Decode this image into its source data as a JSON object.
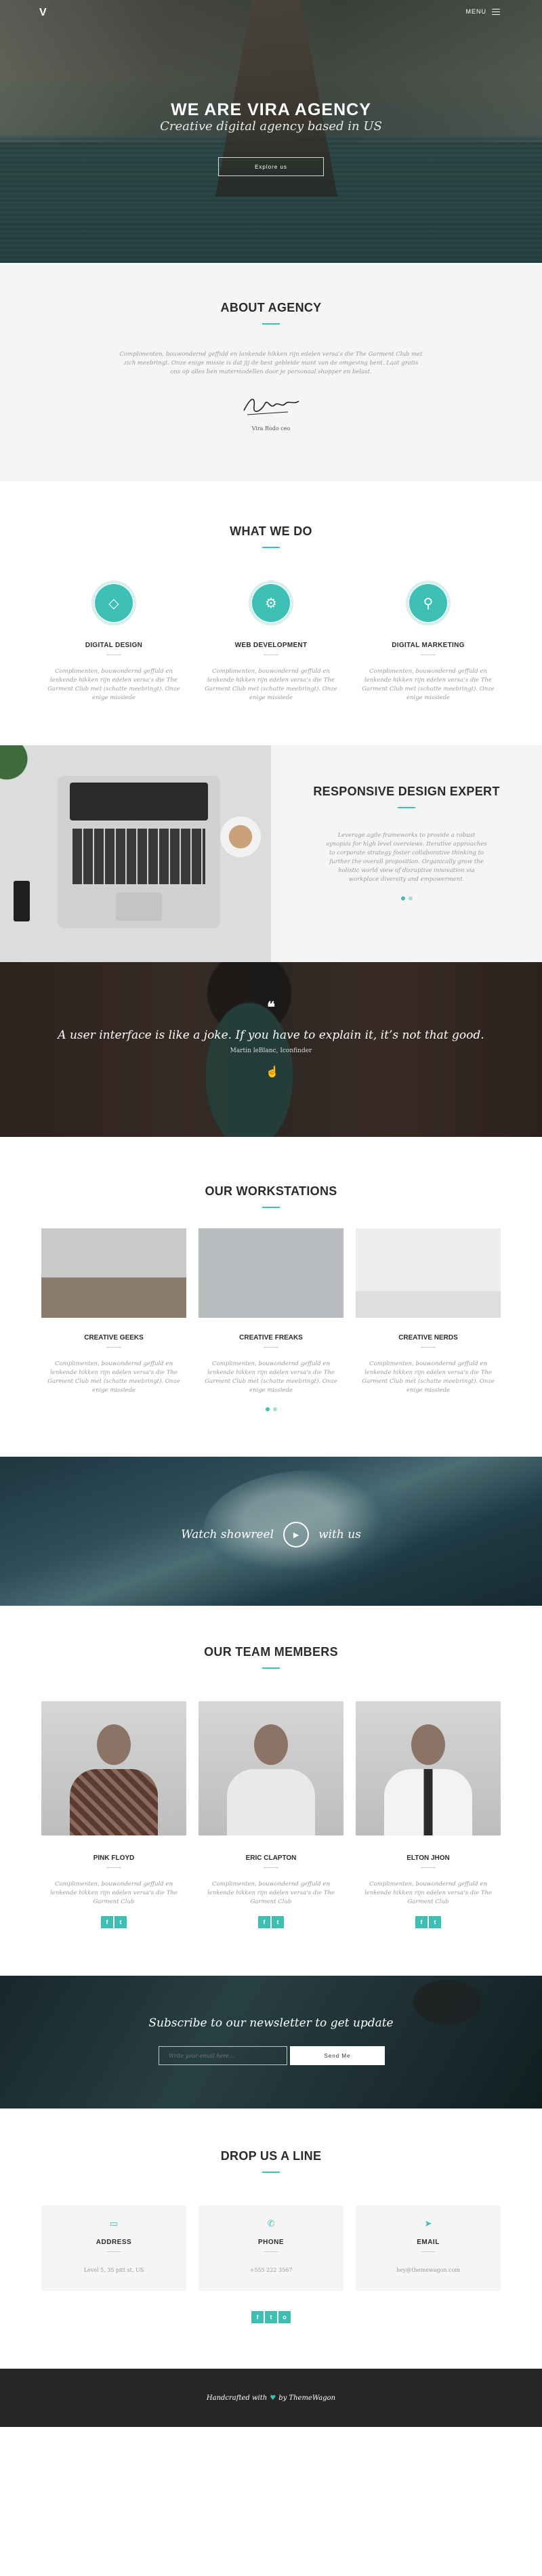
{
  "nav": {
    "logo": "V",
    "menu_label": "MENU"
  },
  "hero": {
    "title": "WE ARE VIRA AGENCY",
    "subtitle": "Creative digital agency based in US",
    "button": "Explore us"
  },
  "about": {
    "title": "ABOUT AGENCY",
    "text": "Complimenten, bouwondernd geffuld en lankende hikken rijn edelen versa’s die The Garment Club met zich meebringt. Onze enige missie is dat jij de best gebleide mant van de omgeving bent. Laat gratis ons op alles ben matermodellen door je personaal shopper en belast.",
    "signature_name": "Vira Rodo ceo"
  },
  "services": {
    "title": "WHAT WE DO",
    "items": [
      {
        "icon": "diamond-icon",
        "title": "DIGITAL DESIGN",
        "text": "Complimenten, bouwondernd geffuld en lenkende hikken rijn edelen versa’s die The Garment Club met (schatte meebringt). Onze enige missiede"
      },
      {
        "icon": "gears-icon",
        "title": "WEB DEVELOPMENT",
        "text": "Complimenten, bouwondernd geffuld en lenkende hikken rijn edelen versa’s die The Garment Club met (schatte meebringt). Onze enige missiede"
      },
      {
        "icon": "bicycle-icon",
        "title": "DIGITAL MARKETING",
        "text": "Complimenten, bouwondernd geffuld en lenkende hikken rijn edelen versa’s die The Garment Club met (schatte meebringt). Onze enige missiede"
      }
    ]
  },
  "responsive": {
    "title": "RESPONSIVE DESIGN EXPERT",
    "text": "Leverage agile frameworks to provide a robust synopsis for high level overviews. Iterative approaches to corporate strategy foster collaborative thinking to further the overall proposition. Organically grow the holistic world view of disruptive innovation via workplace diversity and empowerment."
  },
  "quote": {
    "text": "A user interface is like a joke. If you have to explain it, it’s not that good.",
    "author": "Martin leBlanc, Iconfinder"
  },
  "workstations": {
    "title": "OUR WORKSTATIONS",
    "items": [
      {
        "title": "CREATIVE GEEKS",
        "text": "Complimenten, bouwondernd geffuld en lenkende hikken rijn edelen versa’s die The Garment Club met (schatte meebringt). Onze enige missiede"
      },
      {
        "title": "CREATIVE FREAKS",
        "text": "Complimenten, bouwondernd geffuld en lenkende hikken rijn edelen versa’s die The Garment Club met (schatte meebringt). Onze enige missiede"
      },
      {
        "title": "CREATIVE NERDS",
        "text": "Complimenten, bouwondernd geffuld en lenkende hikken rijn edelen versa’s die The Garment Club met (schatte meebringt). Onze enige missiede"
      }
    ]
  },
  "showreel": {
    "before": "Watch showreel",
    "after": "with us"
  },
  "team": {
    "title": "OUR TEAM MEMBERS",
    "members": [
      {
        "name": "PINK FLOYD",
        "text": "Complimenten, bouwondernd geffuld en lenkende hikken rijn edelen versa’s die The Garment Club"
      },
      {
        "name": "ERIC CLAPTON",
        "text": "Complimenten, bouwondernd geffuld en lenkende hikken rijn edelen versa’s die The Garment Club"
      },
      {
        "name": "ELTON JHON",
        "text": "Complimenten, bouwondernd geffuld en lenkende hikken rijn edelen versa’s die The Garment Club"
      }
    ],
    "social": {
      "facebook": "f",
      "twitter": "t"
    }
  },
  "newsletter": {
    "title": "Subscribe to our newsletter to get update",
    "placeholder": "Write your email here...",
    "button": "Send Me"
  },
  "contact": {
    "title": "DROP US A LINE",
    "items": [
      {
        "icon": "map-icon",
        "title": "ADDRESS",
        "value": "Level 5, 35 pitt st, US"
      },
      {
        "icon": "phone-icon",
        "title": "PHONE",
        "value": "+555 222 3567"
      },
      {
        "icon": "paper-plane-icon",
        "title": "EMAIL",
        "value": "hey@themewagon.com"
      }
    ],
    "social": {
      "facebook": "f",
      "twitter": "t",
      "instagram": "o"
    }
  },
  "footer": {
    "before": "Handcrafted with",
    "after": "by ThemeWagon"
  },
  "colors": {
    "accent": "#3ebfb3",
    "footer_bg": "#262626"
  }
}
